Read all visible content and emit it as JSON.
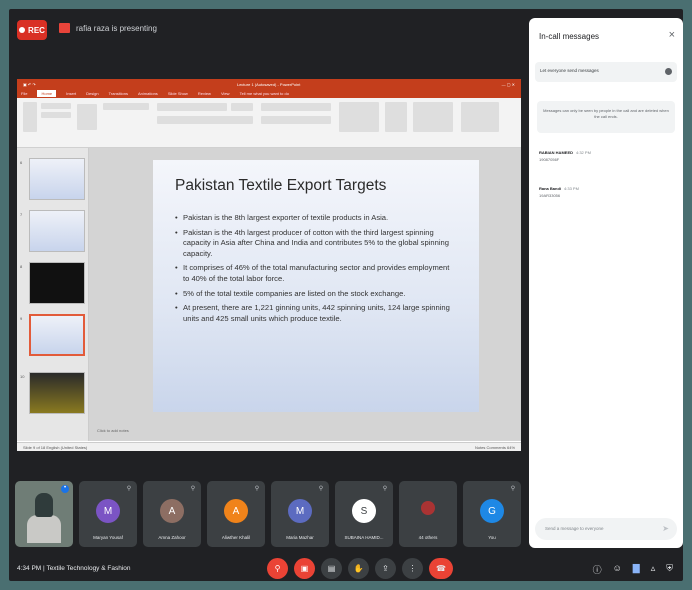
{
  "meeting": {
    "recording_label": "REC",
    "presenting_text": "rafia raza is presenting",
    "time": "4:34 PM",
    "separator": "|",
    "meeting_name": "Textile Technology & Fashion"
  },
  "ppt": {
    "window_title": "Lecture 1 (Autosaved) - PowerPoint",
    "tabs": [
      "File",
      "Home",
      "Insert",
      "Design",
      "Transitions",
      "Animations",
      "Slide Show",
      "Review",
      "View",
      "Tell me what you want to do"
    ],
    "active_tab": "Home",
    "thumb_numbers": [
      "6",
      "7",
      "8",
      "9",
      "10"
    ],
    "notes_placeholder": "Click to add notes",
    "status_left": "Slide 9 of 18    English (United States)",
    "status_right": "Notes   Comments   64%"
  },
  "slide": {
    "title": "Pakistan Textile Export Targets",
    "bullets": [
      "Pakistan is the 8th largest exporter of textile products in Asia.",
      "Pakistan is the 4th largest producer of cotton with the third largest spinning capacity in Asia after China and India and contributes 5% to the global spinning capacity.",
      "It comprises of 46% of the total manufacturing sector and provides employment to 40% of the total labor force.",
      "5% of the total textile companies are listed on the stock exchange.",
      "At present, there are 1,221 ginning units, 442 spinning units, 124 large spinning units and 425 small units which produce textile."
    ]
  },
  "chat": {
    "title": "In-call messages",
    "close": "×",
    "toggle_label": "Let everyone send messages",
    "info": "Messages can only be seen by people in the call and are deleted when the call ends.",
    "messages": [
      {
        "sender": "RABIAN HAMEED",
        "time": "4:32 PM",
        "text": "19087056F"
      },
      {
        "sender": "Rana Bandi",
        "time": "4:33 PM",
        "text": "19AR33056"
      }
    ],
    "input_placeholder": "Send a message to everyone",
    "send_icon": "send-icon"
  },
  "participants": [
    {
      "name": "",
      "initial": "",
      "color": "#6f7d76",
      "self": true
    },
    {
      "name": "Maryan Yousaf",
      "initial": "M",
      "color": "#7b54c4"
    },
    {
      "name": "Amna Zahoor",
      "initial": "A",
      "color": "#c0c0c0"
    },
    {
      "name": "Aliwther Khalil",
      "initial": "A",
      "color": "#f0831a"
    },
    {
      "name": "Maria Mazhar",
      "initial": "M",
      "color": "#5c6bc0"
    },
    {
      "name": "SUBAINA HAMID...",
      "initial": "S",
      "color": "#ffffff"
    },
    {
      "name": "44 others",
      "initial": "",
      "color": "#3c4043"
    },
    {
      "name": "You",
      "initial": "G",
      "color": "#1e88e5"
    }
  ]
}
